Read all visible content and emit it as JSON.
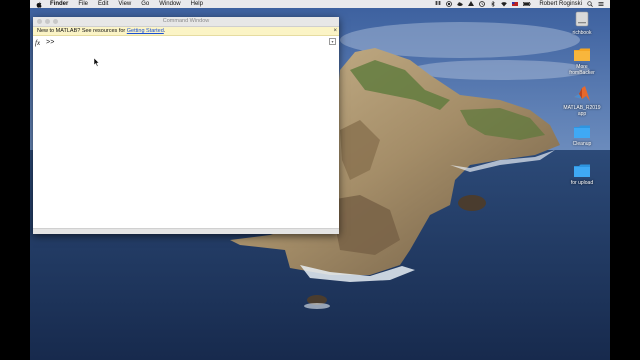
{
  "menubar": {
    "items": [
      "Finder",
      "File",
      "Edit",
      "View",
      "Go",
      "Window",
      "Help"
    ],
    "user": "Robert Roginski"
  },
  "matlab_window": {
    "title": "Command Window",
    "banner_text": "New to MATLAB? See resources for ",
    "banner_link": "Getting Started",
    "banner_end": ".",
    "fx_symbol": "fx",
    "prompt": ">>"
  },
  "desktop_icons": [
    {
      "label": "richbook",
      "icon": "drive-icon"
    },
    {
      "label": "More\nfromBacker",
      "icon": "folder-icon"
    },
    {
      "label": "MATLAB_R2019\napp",
      "icon": "matlab-app-icon"
    },
    {
      "label": "Cleanup",
      "icon": "folder-icon"
    },
    {
      "label": "for upload",
      "icon": "folder-icon"
    }
  ],
  "colors": {
    "ocean": "#243a63",
    "sky": "#4a6ea8",
    "banner": "#fbf4c6",
    "folder": "#3fa9f5"
  }
}
